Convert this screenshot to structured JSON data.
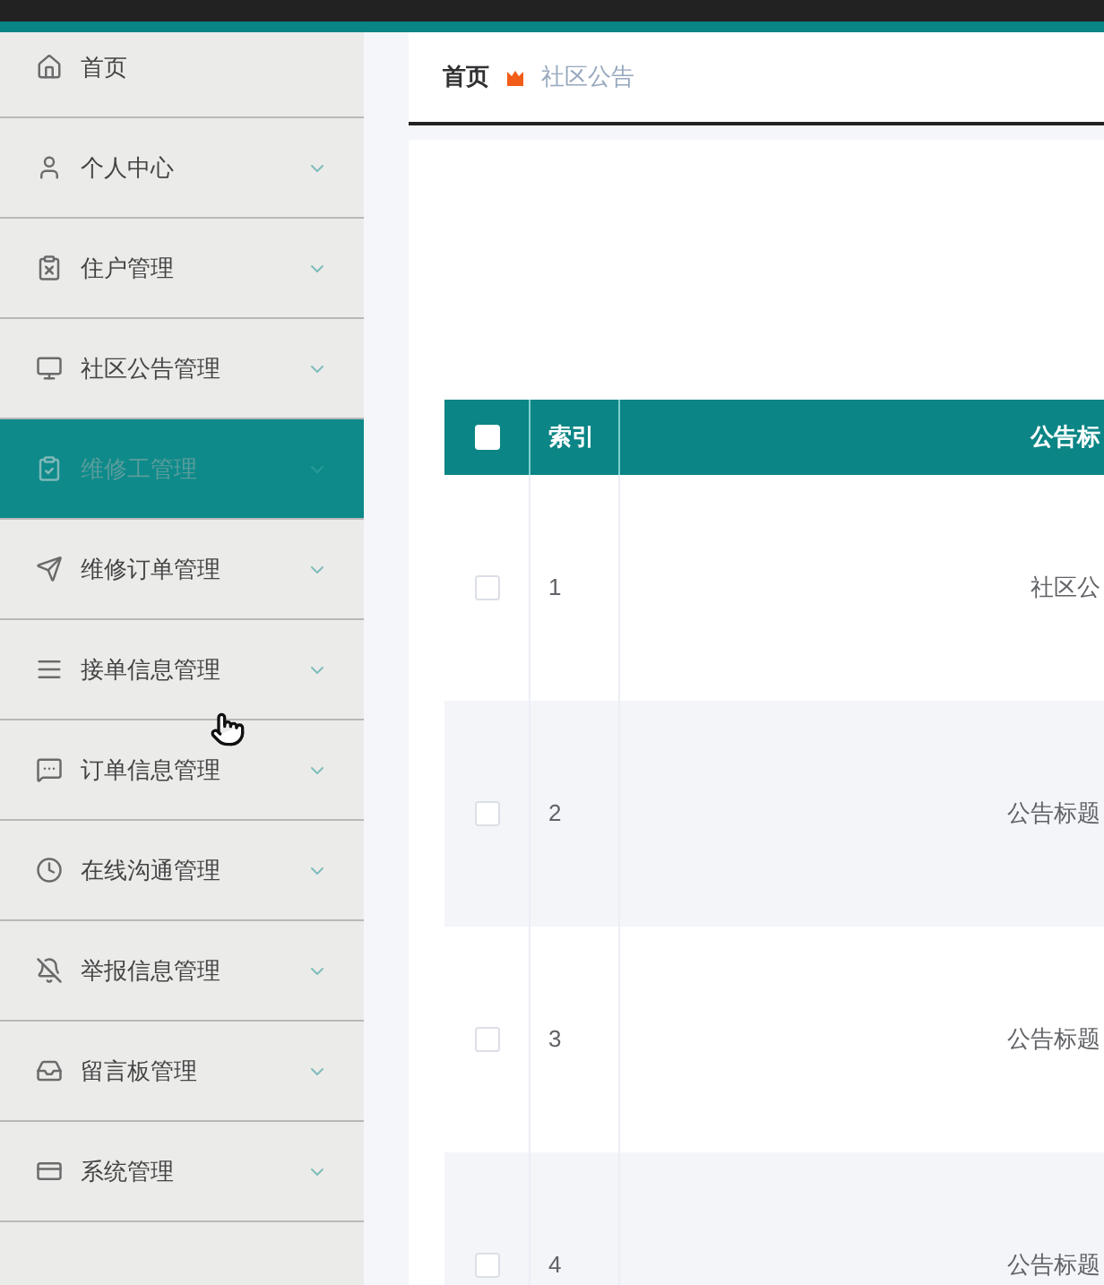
{
  "sidebar": {
    "items": [
      {
        "label": "首页",
        "expandable": false,
        "selected": false
      },
      {
        "label": "个人中心",
        "expandable": true,
        "selected": false
      },
      {
        "label": "住户管理",
        "expandable": true,
        "selected": false
      },
      {
        "label": "社区公告管理",
        "expandable": true,
        "selected": false
      },
      {
        "label": "维修工管理",
        "expandable": true,
        "selected": true
      },
      {
        "label": "维修订单管理",
        "expandable": true,
        "selected": false
      },
      {
        "label": "接单信息管理",
        "expandable": true,
        "selected": false
      },
      {
        "label": "订单信息管理",
        "expandable": true,
        "selected": false
      },
      {
        "label": "在线沟通管理",
        "expandable": true,
        "selected": false
      },
      {
        "label": "举报信息管理",
        "expandable": true,
        "selected": false
      },
      {
        "label": "留言板管理",
        "expandable": true,
        "selected": false
      },
      {
        "label": "系统管理",
        "expandable": true,
        "selected": false
      }
    ]
  },
  "breadcrumb": {
    "home": "首页",
    "current": "社区公告"
  },
  "table": {
    "header_checked": false,
    "columns": [
      "索引",
      "公告标"
    ],
    "rows": [
      {
        "checked": false,
        "index": "1",
        "title": "社区公"
      },
      {
        "checked": false,
        "index": "2",
        "title": "公告标题"
      },
      {
        "checked": false,
        "index": "3",
        "title": "公告标题"
      },
      {
        "checked": false,
        "index": "4",
        "title": "公告标题"
      }
    ]
  }
}
